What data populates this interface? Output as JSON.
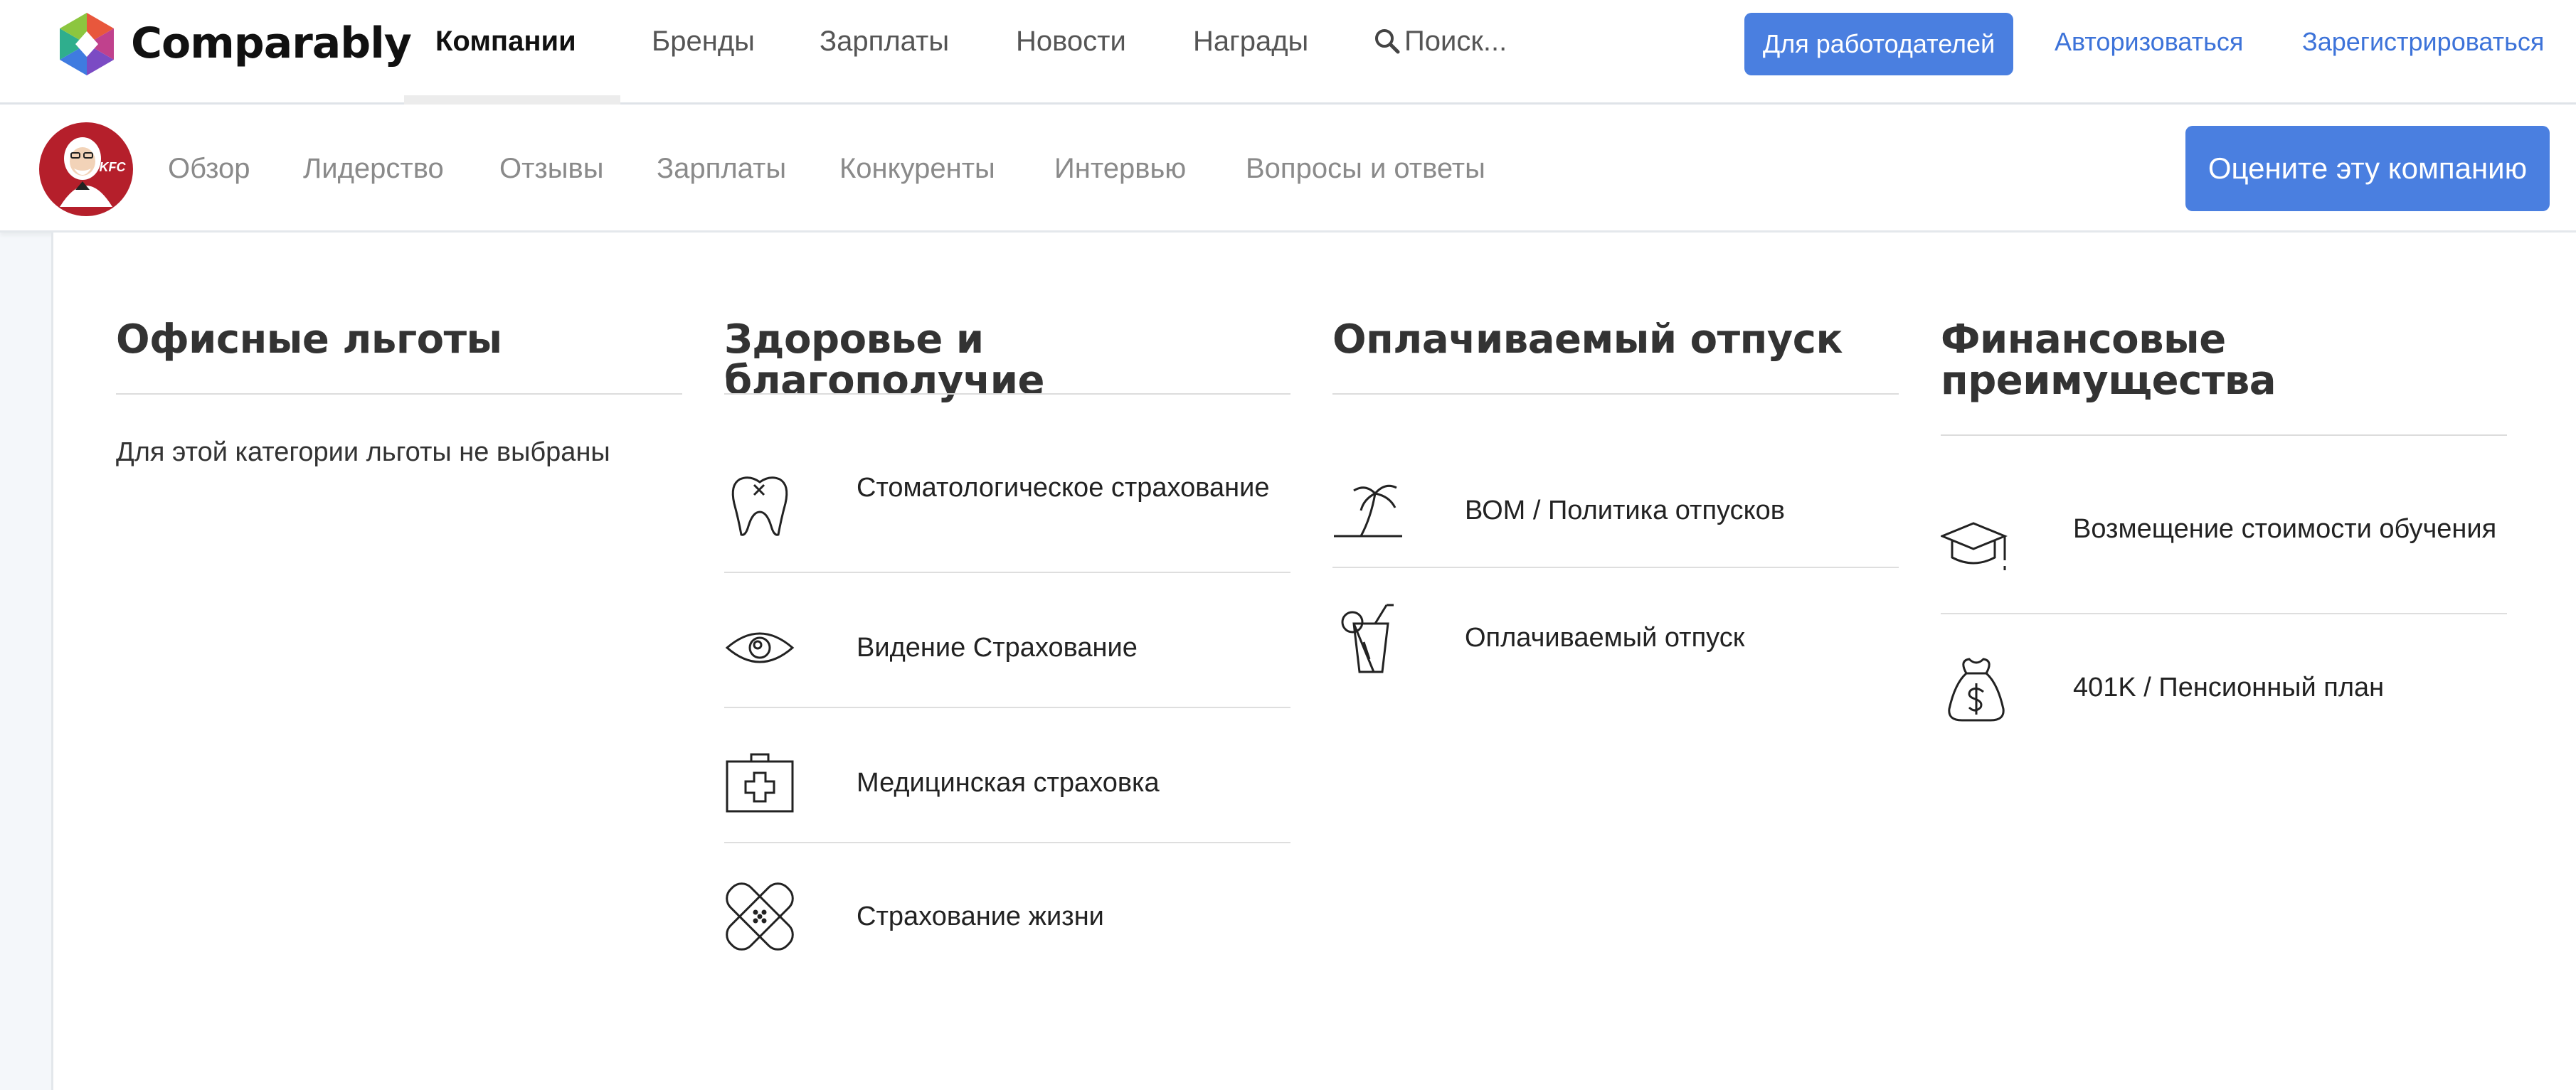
{
  "topnav": {
    "brand": "Comparably",
    "items": [
      "Компании",
      "Бренды",
      "Зарплаты",
      "Новости",
      "Награды"
    ],
    "active": "Компании",
    "search_label": "Поиск...",
    "employers_button": "Для работодателей",
    "login_link": "Авторизоваться",
    "register_link": "Зарегистрироваться"
  },
  "subnav": {
    "company_logo_text": "KFC",
    "items": [
      "Обзор",
      "Лидерство",
      "Отзывы",
      "Зарплаты",
      "Конкуренты",
      "Интервью",
      "Вопросы и ответы"
    ],
    "rate_button": "Оцените эту компанию"
  },
  "categories": [
    {
      "title": "Офисные льготы",
      "empty_text": "Для этой категории льготы не выбраны",
      "benefits": []
    },
    {
      "title": "Здоровье и благополучие",
      "benefits": [
        {
          "icon": "tooth-icon",
          "label": "Стоматологическое страхование"
        },
        {
          "icon": "eye-icon",
          "label": "Видение Страхование"
        },
        {
          "icon": "medical-kit-icon",
          "label": "Медицинская страховка"
        },
        {
          "icon": "bandage-icon",
          "label": "Страхование жизни"
        }
      ]
    },
    {
      "title": "Оплачиваемый отпуск",
      "benefits": [
        {
          "icon": "palm-tree-icon",
          "label": "ВОМ / Политика отпусков"
        },
        {
          "icon": "cocktail-icon",
          "label": "Оплачиваемый отпуск"
        }
      ]
    },
    {
      "title": "Финансовые преимущества",
      "benefits": [
        {
          "icon": "graduation-cap-icon",
          "label": "Возмещение стоимости обучения"
        },
        {
          "icon": "money-bag-icon",
          "label": "401K / Пенсионный план"
        }
      ]
    }
  ],
  "colors": {
    "accent": "#4a7fe0",
    "link": "#3d73d9",
    "heading": "#333333",
    "background": "#f4f7fa"
  }
}
